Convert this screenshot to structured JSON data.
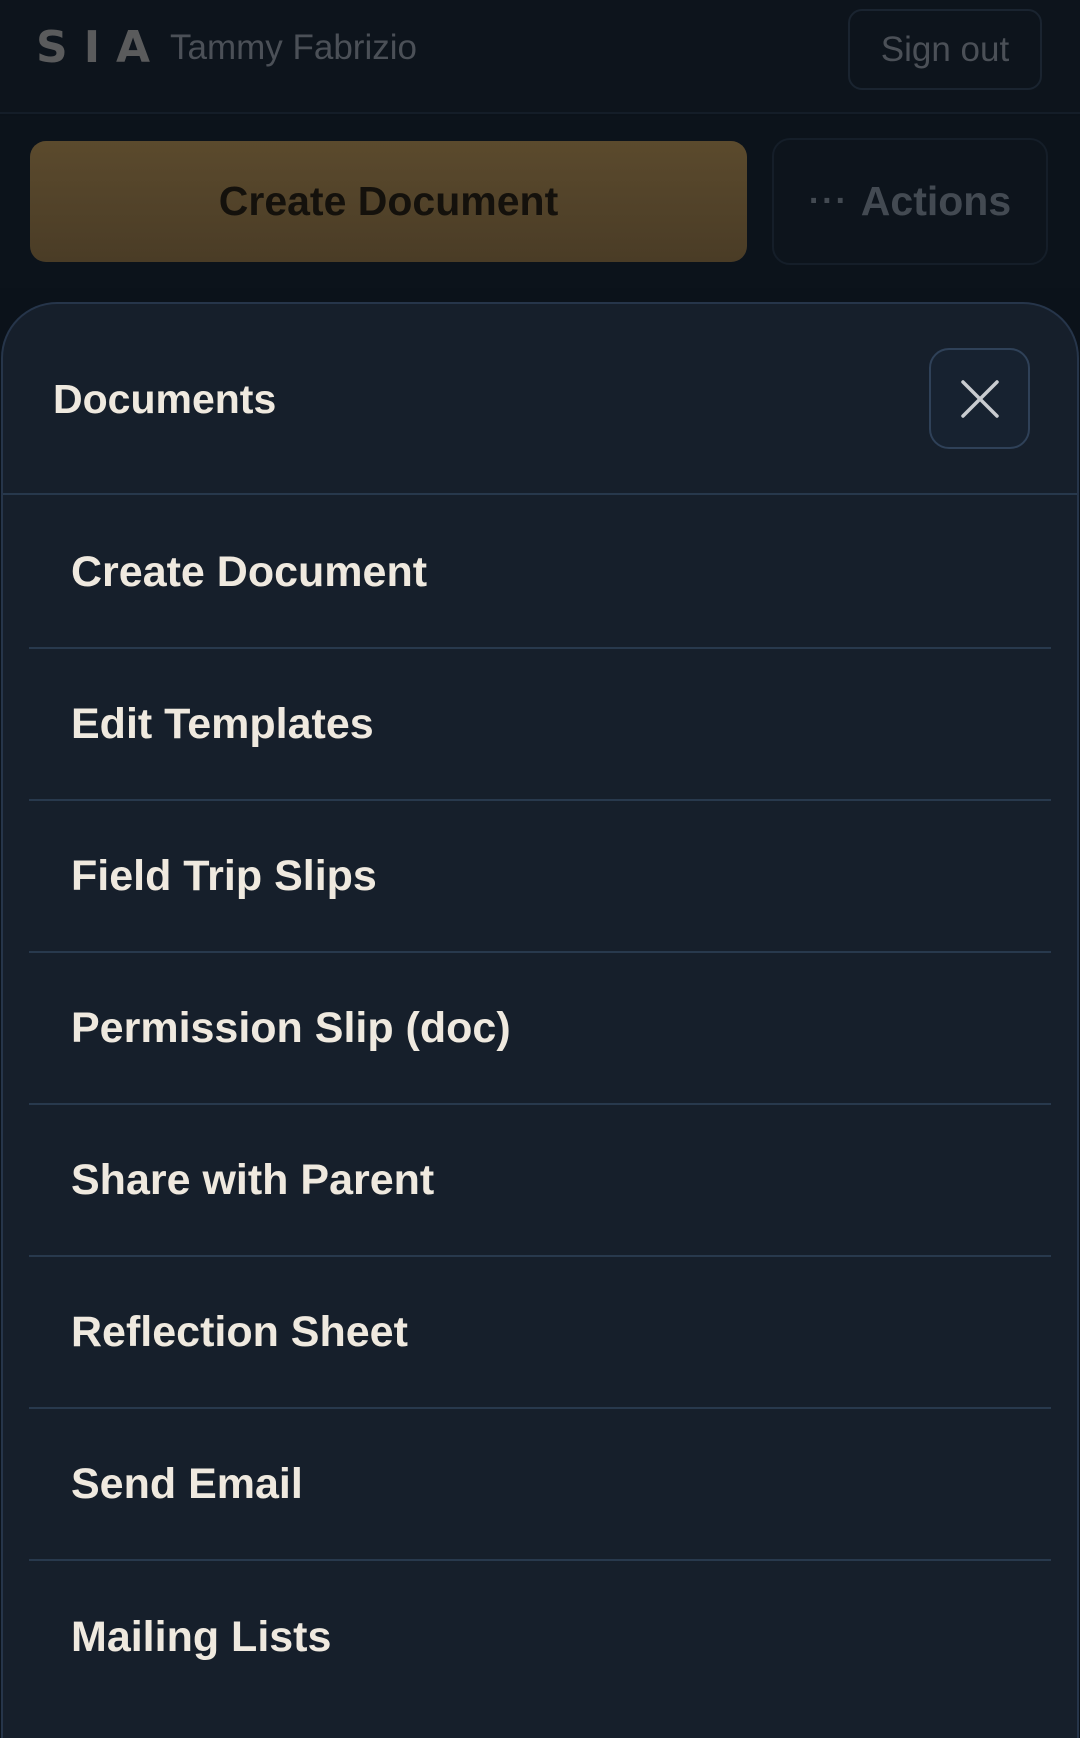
{
  "header": {
    "logo": "SIA",
    "user_name": "Tammy Fabrizio",
    "signout_label": "Sign out"
  },
  "toolbar": {
    "create_label": "Create Document",
    "actions_label": "Actions",
    "actions_icon": "more-dots-icon"
  },
  "sheet": {
    "title": "Documents",
    "close_icon": "close-icon",
    "items": [
      {
        "label": "Create Document"
      },
      {
        "label": "Edit Templates"
      },
      {
        "label": "Field Trip Slips"
      },
      {
        "label": "Permission Slip (doc)"
      },
      {
        "label": "Share with Parent"
      },
      {
        "label": "Reflection Sheet"
      },
      {
        "label": "Send Email"
      },
      {
        "label": "Mailing Lists"
      }
    ]
  },
  "colors": {
    "accent": "#5b4a2d",
    "sheet_bg": "#161f2b",
    "text": "#efe9df"
  }
}
